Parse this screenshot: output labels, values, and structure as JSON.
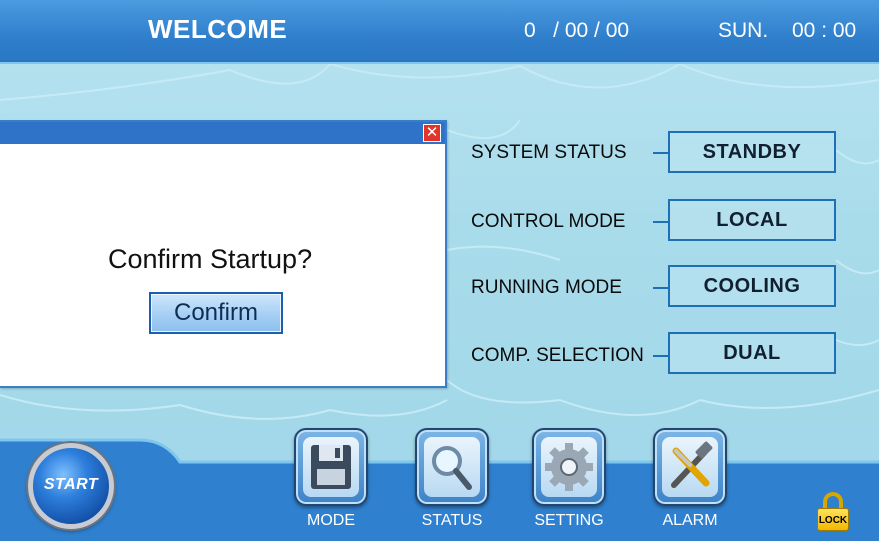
{
  "header": {
    "welcome": "WELCOME",
    "date": "0   / 00 / 00",
    "day_of_week": "SUN.",
    "time": "00 : 00"
  },
  "dialog": {
    "message": "Confirm Startup?",
    "confirm_label": "Confirm",
    "close_icon": "close-icon"
  },
  "status": [
    {
      "label": "SYSTEM STATUS",
      "value": "STANDBY"
    },
    {
      "label": "CONTROL MODE",
      "value": "LOCAL"
    },
    {
      "label": "RUNNING MODE",
      "value": "COOLING"
    },
    {
      "label": "COMP. SELECTION",
      "value": "DUAL"
    }
  ],
  "bottom": {
    "start_label": "START",
    "tools": [
      {
        "label": "MODE",
        "icon": "floppy-disk-icon"
      },
      {
        "label": "STATUS",
        "icon": "magnifier-icon"
      },
      {
        "label": "SETTING",
        "icon": "gear-icon"
      },
      {
        "label": "ALARM",
        "icon": "tools-icon"
      }
    ],
    "lock_label": "LOCK"
  },
  "colors": {
    "header": "#2f7fcc",
    "background": "#a9dceb",
    "status_border": "#1f6fb7",
    "close_button": "#e2342a"
  }
}
